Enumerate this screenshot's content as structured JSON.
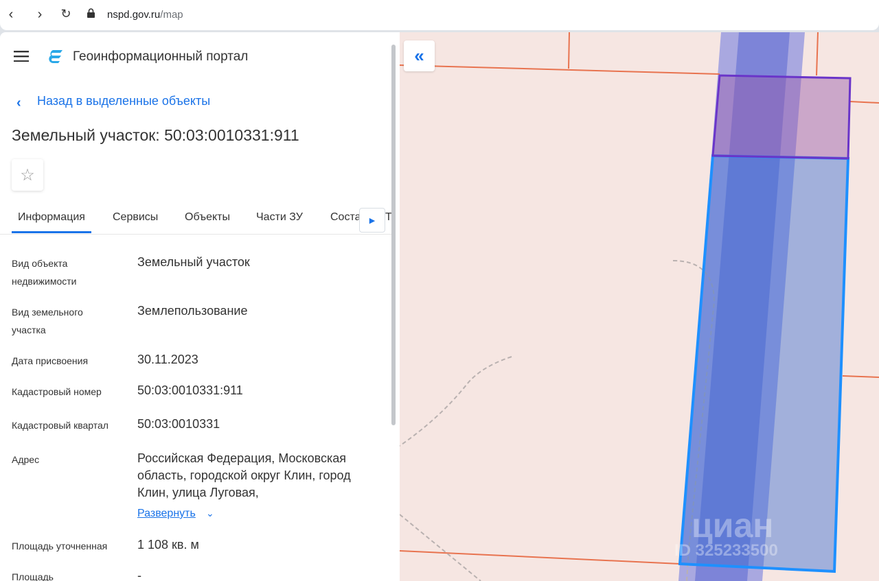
{
  "browser": {
    "url_host": "nspd.gov.ru",
    "url_path": "/map"
  },
  "header": {
    "title": "Геоинформационный портал"
  },
  "back_link": "Назад в выделенные объекты",
  "page_title": "Земельный участок: 50:03:0010331:911",
  "tabs": [
    {
      "label": "Информация",
      "active": true
    },
    {
      "label": "Сервисы"
    },
    {
      "label": "Объекты"
    },
    {
      "label": "Части ЗУ"
    },
    {
      "label": "Соста"
    },
    {
      "label": "Т"
    }
  ],
  "fields": [
    {
      "label": "Вид объекта недвижимости",
      "value": "Земельный участок"
    },
    {
      "label": "Вид земельного участка",
      "value": "Землепользование"
    },
    {
      "label": "Дата присвоения",
      "value": "30.11.2023"
    },
    {
      "label": "Кадастровый номер",
      "value": "50:03:0010331:911"
    },
    {
      "label": "Кадастровый квартал",
      "value": "50:03:0010331"
    },
    {
      "label": "Адрес",
      "value": "Российская Федерация, Московская область, городской округ Клин, город Клин, улица Луговая,"
    },
    {
      "label": "Площадь уточненная",
      "value": "1 108 кв. м"
    },
    {
      "label": "Площадь",
      "value": "-"
    }
  ],
  "expand_link": "Развернуть",
  "watermark": {
    "brand": "циан",
    "id": "ID 325233500"
  },
  "colors": {
    "accent": "#1a73e8",
    "parcel_border": "#1e90ff",
    "selected_border": "#6a35c9",
    "boundary": "#e8734f",
    "map_bg": "#f6e6e2"
  }
}
